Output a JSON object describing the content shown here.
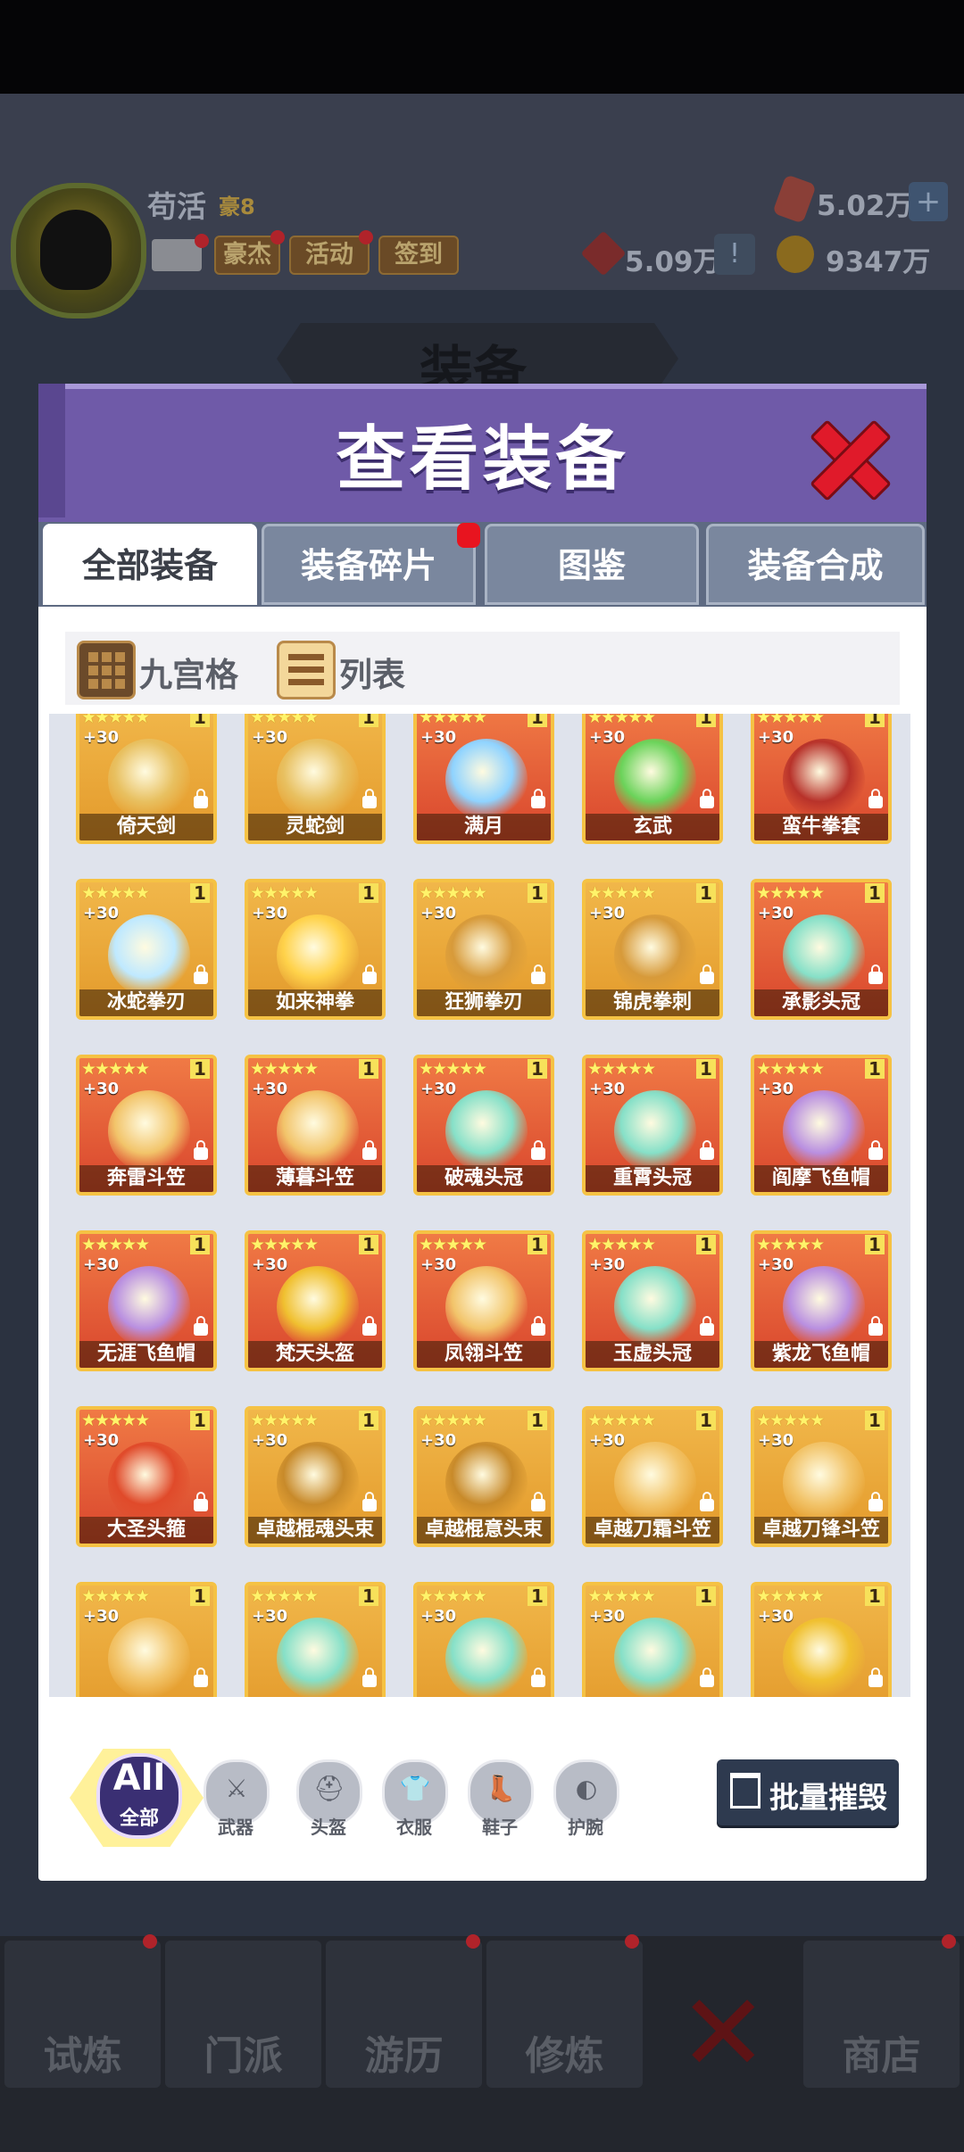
{
  "background": {
    "player_name": "苟活",
    "vip_label": "豪8",
    "top_buttons": [
      "豪杰",
      "活动",
      "签到"
    ],
    "resources": {
      "gems": "5.02万",
      "red_tokens": "5.09万",
      "gold": "9347万"
    },
    "screen_title": "装备",
    "nav_tabs": [
      "试炼",
      "门派",
      "游历",
      "修炼",
      "商店"
    ]
  },
  "dialog": {
    "title": "查看装备",
    "tabs": [
      {
        "label": "全部装备",
        "active": true
      },
      {
        "label": "装备碎片",
        "active": false,
        "notification": true
      },
      {
        "label": "图鉴",
        "active": false
      },
      {
        "label": "装备合成",
        "active": false
      }
    ],
    "view_modes": [
      {
        "label": "九宫格",
        "icon": "grid-icon"
      },
      {
        "label": "列表",
        "icon": "list-icon"
      }
    ],
    "items": [
      {
        "name": "倚天剑",
        "stars": "★★★★★",
        "level": "1",
        "plus": "+30",
        "rarity": "gold",
        "icon": "sword-icon"
      },
      {
        "name": "灵蛇剑",
        "stars": "★★★★★",
        "level": "1",
        "plus": "+30",
        "rarity": "gold",
        "icon": "sword-icon"
      },
      {
        "name": "满月",
        "stars": "★★★★★",
        "level": "1",
        "plus": "+30",
        "rarity": "red",
        "icon": "crescent-blade-icon"
      },
      {
        "name": "玄武",
        "stars": "★★★★★",
        "level": "1",
        "plus": "+30",
        "rarity": "red",
        "icon": "jade-claw-icon"
      },
      {
        "name": "蛮牛拳套",
        "stars": "★★★★★",
        "level": "1",
        "plus": "+30",
        "rarity": "red",
        "icon": "gauntlet-icon"
      },
      {
        "name": "冰蛇拳刃",
        "stars": "★★★★★",
        "level": "1",
        "plus": "+30",
        "rarity": "gold",
        "icon": "ice-claw-icon"
      },
      {
        "name": "如来神拳",
        "stars": "★★★★★",
        "level": "1",
        "plus": "+30",
        "rarity": "gold",
        "icon": "fist-icon"
      },
      {
        "name": "狂狮拳刃",
        "stars": "★★★★★",
        "level": "1",
        "plus": "+30",
        "rarity": "gold",
        "icon": "claw-icon"
      },
      {
        "name": "锦虎拳刺",
        "stars": "★★★★★",
        "level": "1",
        "plus": "+30",
        "rarity": "gold",
        "icon": "claw-icon"
      },
      {
        "name": "承影头冠",
        "stars": "★★★★★",
        "level": "1",
        "plus": "+30",
        "rarity": "red",
        "icon": "crown-icon"
      },
      {
        "name": "奔雷斗笠",
        "stars": "★★★★★",
        "level": "1",
        "plus": "+30",
        "rarity": "red",
        "icon": "hat-icon"
      },
      {
        "name": "薄暮斗笠",
        "stars": "★★★★★",
        "level": "1",
        "plus": "+30",
        "rarity": "red",
        "icon": "hat-icon"
      },
      {
        "name": "破魂头冠",
        "stars": "★★★★★",
        "level": "1",
        "plus": "+30",
        "rarity": "red",
        "icon": "crown-icon"
      },
      {
        "name": "重霄头冠",
        "stars": "★★★★★",
        "level": "1",
        "plus": "+30",
        "rarity": "red",
        "icon": "crown-icon"
      },
      {
        "name": "阎摩飞鱼帽",
        "stars": "★★★★★",
        "level": "1",
        "plus": "+30",
        "rarity": "red",
        "icon": "cap-icon"
      },
      {
        "name": "无涯飞鱼帽",
        "stars": "★★★★★",
        "level": "1",
        "plus": "+30",
        "rarity": "red",
        "icon": "cap-icon"
      },
      {
        "name": "梵天头盔",
        "stars": "★★★★★",
        "level": "1",
        "plus": "+30",
        "rarity": "red",
        "icon": "helmet-icon"
      },
      {
        "name": "凤翎斗笠",
        "stars": "★★★★★",
        "level": "1",
        "plus": "+30",
        "rarity": "red",
        "icon": "hat-icon"
      },
      {
        "name": "玉虚头冠",
        "stars": "★★★★★",
        "level": "1",
        "plus": "+30",
        "rarity": "red",
        "icon": "crown-icon"
      },
      {
        "name": "紫龙飞鱼帽",
        "stars": "★★★★★",
        "level": "1",
        "plus": "+30",
        "rarity": "red",
        "icon": "cap-icon"
      },
      {
        "name": "大圣头箍",
        "stars": "★★★★★",
        "level": "1",
        "plus": "+30",
        "rarity": "red",
        "icon": "circlet-icon"
      },
      {
        "name": "卓越棍魂头束",
        "stars": "★★★★★",
        "level": "1",
        "plus": "+30",
        "rarity": "gold",
        "icon": "headband-icon"
      },
      {
        "name": "卓越棍意头束",
        "stars": "★★★★★",
        "level": "1",
        "plus": "+30",
        "rarity": "gold",
        "icon": "headband-icon"
      },
      {
        "name": "卓越刀霜斗笠",
        "stars": "★★★★★",
        "level": "1",
        "plus": "+30",
        "rarity": "gold",
        "icon": "hat-icon"
      },
      {
        "name": "卓越刀锋斗笠",
        "stars": "★★★★★",
        "level": "1",
        "plus": "+30",
        "rarity": "gold",
        "icon": "hat-icon"
      },
      {
        "name": "",
        "stars": "★★★★★",
        "level": "1",
        "plus": "+30",
        "rarity": "gold",
        "icon": "hat-icon"
      },
      {
        "name": "",
        "stars": "★★★★★",
        "level": "1",
        "plus": "+30",
        "rarity": "gold",
        "icon": "crown-icon"
      },
      {
        "name": "",
        "stars": "★★★★★",
        "level": "1",
        "plus": "+30",
        "rarity": "gold",
        "icon": "crown-icon"
      },
      {
        "name": "",
        "stars": "★★★★★",
        "level": "1",
        "plus": "+30",
        "rarity": "gold",
        "icon": "crown-icon"
      },
      {
        "name": "",
        "stars": "★★★★★",
        "level": "1",
        "plus": "+30",
        "rarity": "gold",
        "icon": "helmet-icon"
      }
    ],
    "filters": {
      "all_big": "All",
      "all_small": "全部",
      "categories": [
        {
          "label": "武器",
          "glyph": "⚔",
          "icon": "weapon-icon"
        },
        {
          "label": "头盔",
          "glyph": "⛑",
          "icon": "helmet-icon"
        },
        {
          "label": "衣服",
          "glyph": "👕",
          "icon": "clothes-icon"
        },
        {
          "label": "鞋子",
          "glyph": "👢",
          "icon": "shoes-icon"
        },
        {
          "label": "护腕",
          "glyph": "◐",
          "icon": "bracer-icon"
        }
      ]
    },
    "batch_destroy_label": "批量摧毁"
  },
  "colors": {
    "dialog_header": "#6f5aa8",
    "close_red": "#e01a2a",
    "card_gold": "#e39a2b",
    "card_red": "#d9462d"
  }
}
